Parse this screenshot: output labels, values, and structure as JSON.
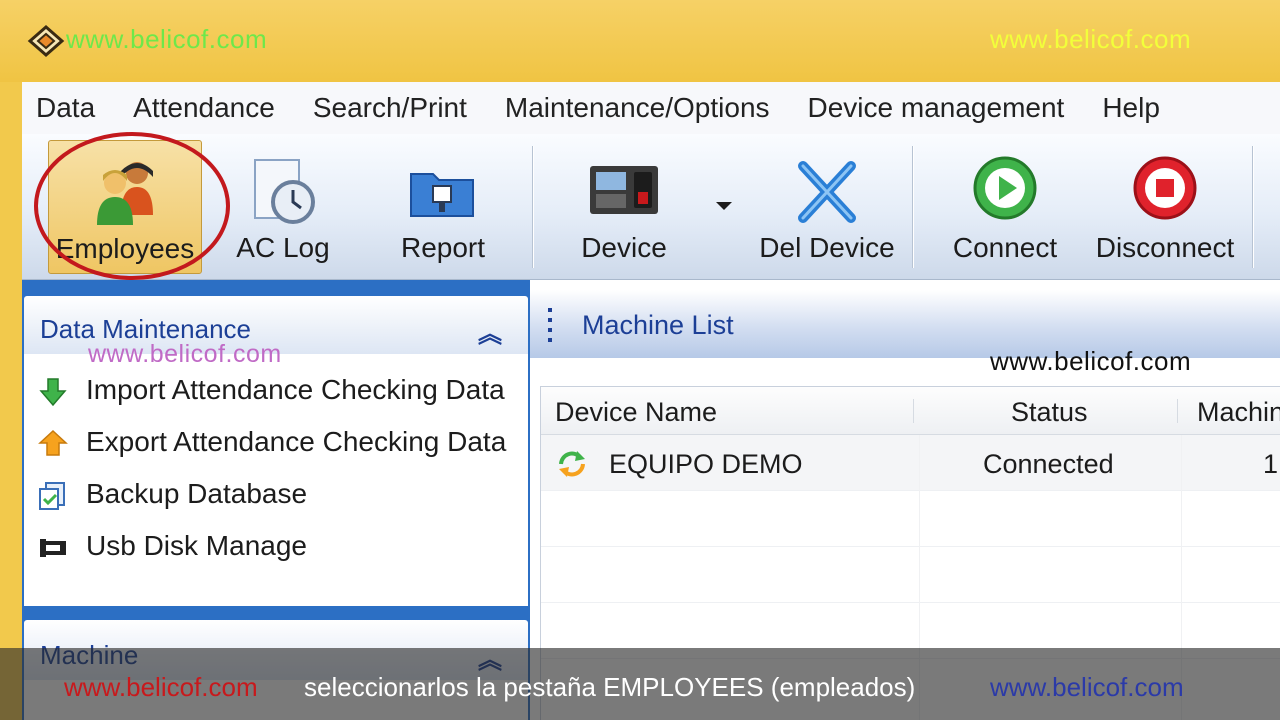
{
  "watermarks": {
    "top_left": "www.belicof.com",
    "top_right": "www.belicof.com",
    "left_panel": "www.belicof.com",
    "right_panel": "www.belicof.com"
  },
  "menu": [
    "Data",
    "Attendance",
    "Search/Print",
    "Maintenance/Options",
    "Device management",
    "Help"
  ],
  "toolbar": {
    "employees": "Employees",
    "ac_log": "AC Log",
    "report": "Report",
    "device": "Device",
    "del_device": "Del Device",
    "connect": "Connect",
    "disconnect": "Disconnect"
  },
  "left_panel": {
    "section1_title": "Data Maintenance",
    "items": [
      {
        "label": "Import Attendance Checking Data",
        "icon": "import-arrow-icon"
      },
      {
        "label": "Export Attendance Checking Data",
        "icon": "export-arrow-icon"
      },
      {
        "label": "Backup Database",
        "icon": "backup-icon"
      },
      {
        "label": "Usb Disk Manage",
        "icon": "usb-icon"
      }
    ],
    "section2_title": "Machine"
  },
  "machine_list": {
    "title": "Machine List",
    "columns": [
      "Device Name",
      "Status",
      "Machin"
    ],
    "rows": [
      {
        "name": "EQUIPO DEMO",
        "status": "Connected",
        "machine": "1"
      }
    ]
  },
  "subtitle": {
    "left": "www.belicof.com",
    "text": "seleccionarlos la pestaña EMPLOYEES (empleados)",
    "right": "www.belicof.com"
  },
  "colors": {
    "titlebar": "#f2c94c",
    "panel_blue": "#2c6fc4",
    "header_text": "#1c3f96",
    "highlight_circle": "#c3191d"
  }
}
